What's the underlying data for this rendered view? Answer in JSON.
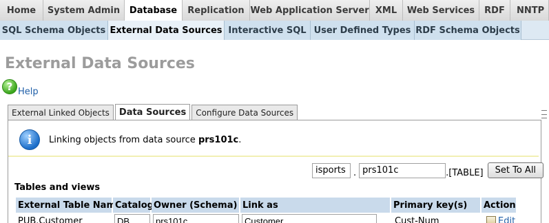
{
  "topnav": {
    "tabs": [
      {
        "label": "Home"
      },
      {
        "label": "System Admin"
      },
      {
        "label": "Database",
        "active": true
      },
      {
        "label": "Replication"
      },
      {
        "label": "Web Application Server"
      },
      {
        "label": "XML"
      },
      {
        "label": "Web Services"
      },
      {
        "label": "RDF"
      },
      {
        "label": "NNTP"
      }
    ]
  },
  "subnav": {
    "tabs": [
      {
        "label": "SQL Schema Objects"
      },
      {
        "label": "External Data Sources",
        "active": true
      },
      {
        "label": "Interactive SQL"
      },
      {
        "label": "User Defined Types"
      },
      {
        "label": "RDF Schema Objects"
      }
    ]
  },
  "page": {
    "title": "External Data Sources",
    "help_label": "Help",
    "help_icon": "?"
  },
  "page_tabs": [
    {
      "label": "External Linked Objects"
    },
    {
      "label": "Data Sources",
      "active": true
    },
    {
      "label": "Configure Data Sources"
    }
  ],
  "info": {
    "icon": "i",
    "text_prefix": "Linking objects from data source ",
    "datasource": "prs101c",
    "text_suffix": "."
  },
  "set_all": {
    "catalog_value": "isports",
    "sep1": ".",
    "owner_value": "prs101c",
    "table_suffix": ".[TABLE]",
    "button_label": "Set To All"
  },
  "tables": {
    "section_title": "Tables and views",
    "columns": [
      "External Table Name",
      "Catalog",
      "Owner (Schema)",
      "Link as",
      "Primary key(s)",
      "Action"
    ],
    "rows": [
      {
        "name": "PUB.Customer",
        "catalog": "DB",
        "owner": "prs101c",
        "link_as": "Customer",
        "primary_key": "Cust-Num",
        "action": "Edit"
      }
    ]
  }
}
